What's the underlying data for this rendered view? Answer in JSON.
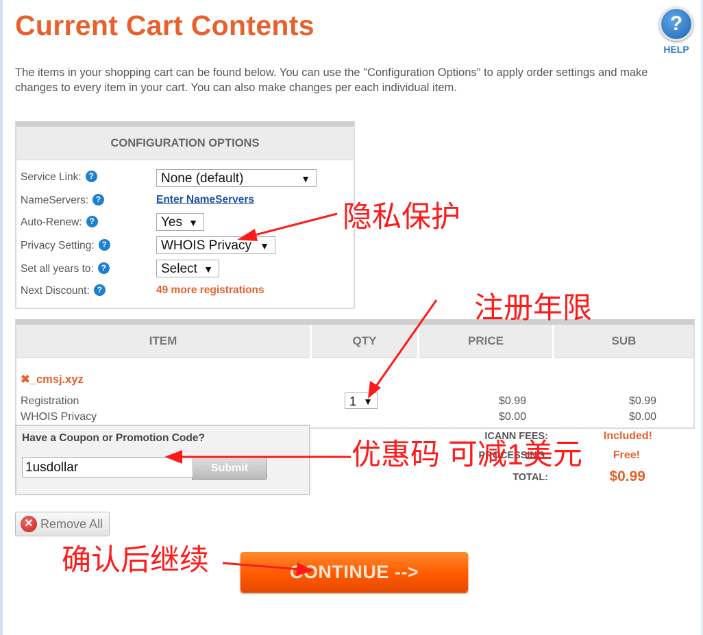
{
  "page": {
    "title": "Current Cart Contents",
    "help_label": "HELP",
    "help_icon": "question-circle-icon",
    "intro": "The items in your shopping cart can be found below. You can use the \"Configuration Options\" to apply order settings and make changes to every item in your cart. You can also make changes per each individual item."
  },
  "config": {
    "heading": "CONFIGURATION OPTIONS",
    "service_link_label": "Service Link:",
    "service_link_value": "None (default)",
    "nameservers_label": "NameServers:",
    "nameservers_link": "Enter NameServers",
    "auto_renew_label": "Auto-Renew:",
    "auto_renew_value": "Yes",
    "privacy_label": "Privacy Setting:",
    "privacy_value": "WHOIS Privacy",
    "years_label": "Set all years to:",
    "years_value": "Select",
    "discount_label": "Next Discount:",
    "discount_value": "49 more registrations"
  },
  "cart": {
    "col_item": "ITEM",
    "col_qty": "QTY",
    "col_price": "PRICE",
    "col_sub": "SUB",
    "domain": "_cmsj.xyz",
    "rows": [
      {
        "label": "Registration",
        "price": "$0.99",
        "sub": "$0.99"
      },
      {
        "label": "WHOIS Privacy",
        "price": "$0.00",
        "sub": "$0.00"
      }
    ],
    "qty": "1"
  },
  "coupon": {
    "title": "Have a Coupon or Promotion Code?",
    "value": "1usdollar",
    "submit": "Submit"
  },
  "totals": {
    "icann_label": "ICANN FEES:",
    "icann_value": "Included!",
    "processing_label": "PROCESSING:",
    "processing_value": "Free!",
    "total_label": "TOTAL:",
    "total_value": "$0.99"
  },
  "actions": {
    "remove_all": "Remove All",
    "continue": "CONTINUE -->"
  },
  "annotations": {
    "privacy": "隐私保护",
    "years": "注册年限",
    "coupon": "优惠码 可减1美元",
    "confirm": "确认后继续"
  },
  "colors": {
    "accent": "#e8602c",
    "annotation": "#ff1a1a",
    "link": "#1a4fa6"
  }
}
